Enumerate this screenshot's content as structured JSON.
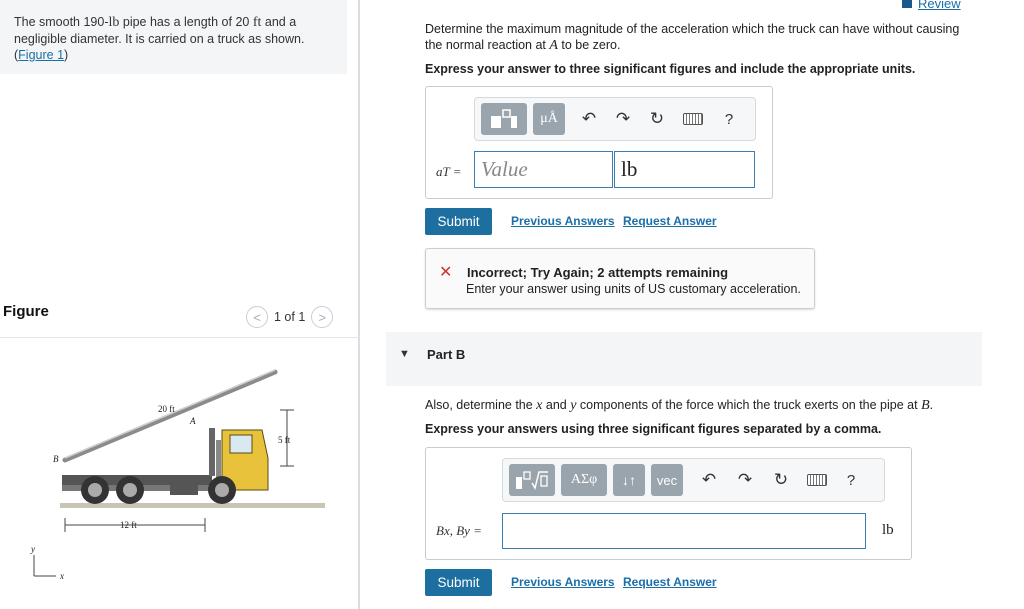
{
  "problem": {
    "text_before": "The smooth 190-",
    "weight_unit": "lb",
    "text_mid": " pipe has a length of 20 ",
    "length_unit": "ft",
    "text_after": " and a negligible diameter. It is carried on a truck as shown.",
    "figure_link_open": "(",
    "figure_link": "Figure 1",
    "figure_link_close": ")"
  },
  "figure": {
    "title": "Figure",
    "pager_text": "1 of 1",
    "prev_icon": "chevron-left-icon",
    "next_icon": "chevron-right-icon",
    "labels": {
      "pipe_length": "20 ft",
      "point_a": "A",
      "height": "5 ft",
      "point_b": "B",
      "base": "12 ft",
      "axis_y": "y",
      "axis_x": "x"
    }
  },
  "header": {
    "review_label": "Review"
  },
  "partA": {
    "question_1": "Determine the maximum magnitude of the acceleration which the truck can have without causing the normal reaction at ",
    "question_var": "A",
    "question_2": " to be zero.",
    "instruction": "Express your answer to three significant figures and include the appropriate units.",
    "toolbar": {
      "templates_icon": "templates-icon",
      "units_label": "μÅ",
      "undo_icon": "undo-icon",
      "redo_icon": "redo-icon",
      "reset_icon": "reset-icon",
      "keyboard_icon": "keyboard-icon",
      "help_label": "?"
    },
    "answer_label": "aT =",
    "value_placeholder": "Value",
    "unit_value": "lb",
    "submit_label": "Submit",
    "previous_answers": "Previous Answers",
    "request_answer": "Request Answer",
    "feedback": {
      "icon": "x-icon",
      "title": "Incorrect; Try Again; 2 attempts remaining",
      "message": "Enter your answer using units of US customary acceleration."
    }
  },
  "partB": {
    "title": "Part B",
    "question_1": "Also, determine the ",
    "var_x": "x",
    "question_2": " and ",
    "var_y": "y",
    "question_3": " components of the force which the truck exerts on the pipe at ",
    "var_b": "B",
    "question_4": ".",
    "instruction": "Express your answers using three significant figures separated by a comma.",
    "toolbar": {
      "templates_icon": "templates-radical-icon",
      "greek_label": "ΑΣφ",
      "swap_label": "↓↑",
      "vec_label": "vec",
      "undo_icon": "undo-icon",
      "redo_icon": "redo-icon",
      "reset_icon": "reset-icon",
      "keyboard_icon": "keyboard-icon",
      "help_label": "?"
    },
    "answer_label": "Bx, By =",
    "unit_label": "lb",
    "submit_label": "Submit",
    "previous_answers": "Previous Answers",
    "request_answer": "Request Answer"
  },
  "colors": {
    "accent": "#1d6fa0",
    "error": "#d6312e",
    "truck": "#e8c23a"
  }
}
